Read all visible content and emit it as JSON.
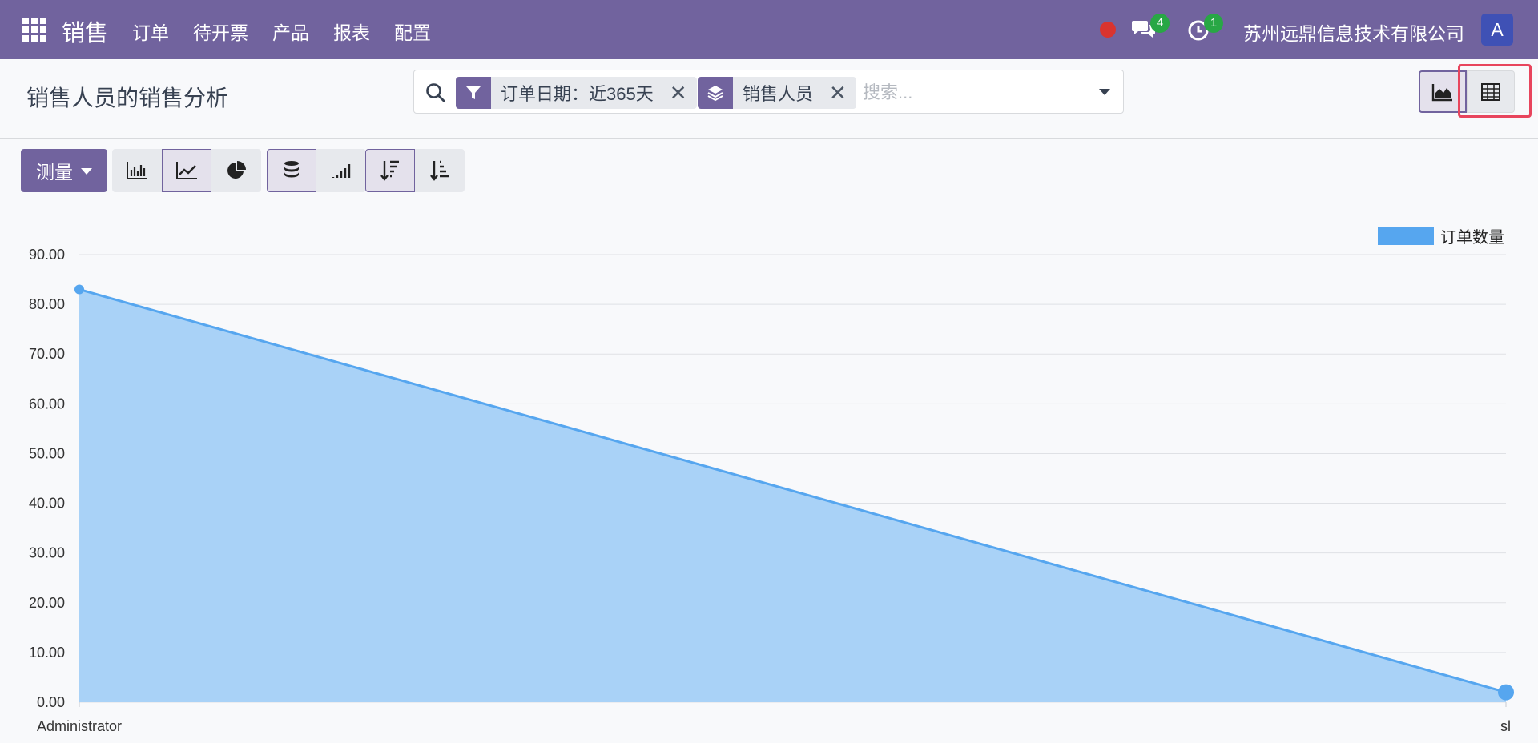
{
  "navbar": {
    "brand": "销售",
    "menu": [
      "订单",
      "待开票",
      "产品",
      "报表",
      "配置"
    ],
    "messages_badge": "4",
    "activities_badge": "1",
    "company": "苏州远鼎信息技术有限公司",
    "avatar_letter": "A",
    "bg_color": "#71639e"
  },
  "control_panel": {
    "title": "销售人员的销售分析",
    "facets": [
      {
        "icon": "filter-icon",
        "label": "订单日期：近365天"
      },
      {
        "icon": "layers-icon",
        "label": "销售人员"
      }
    ],
    "search_placeholder": "搜索..."
  },
  "toolbar": {
    "measure_label": "测量"
  },
  "chart_data": {
    "type": "area",
    "categories": [
      "Administrator",
      "sl"
    ],
    "series": [
      {
        "name": "订单数量",
        "values": [
          83,
          2
        ],
        "color": "#56a6ef"
      }
    ],
    "ylim": [
      0,
      90
    ],
    "yticks": [
      "0.00",
      "10.00",
      "20.00",
      "30.00",
      "40.00",
      "50.00",
      "60.00",
      "70.00",
      "80.00",
      "90.00"
    ],
    "grid": true,
    "legend_position": "top-right"
  }
}
